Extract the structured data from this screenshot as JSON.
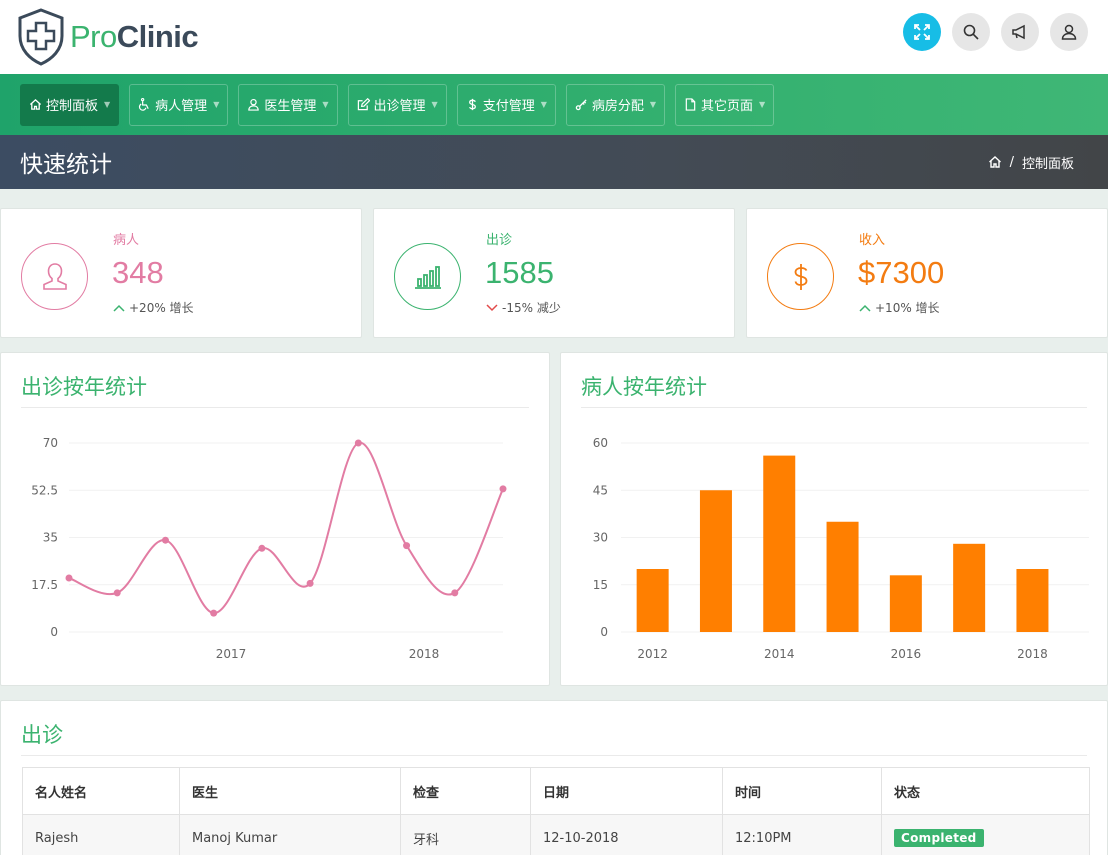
{
  "brand": {
    "part1": "Pro",
    "part2": "Clinic"
  },
  "nav": [
    {
      "label": "控制面板",
      "icon": "home-icon",
      "active": true
    },
    {
      "label": "病人管理",
      "icon": "wheelchair-icon"
    },
    {
      "label": "医生管理",
      "icon": "user-icon"
    },
    {
      "label": "出诊管理",
      "icon": "edit-icon"
    },
    {
      "label": "支付管理",
      "icon": "dollar-icon"
    },
    {
      "label": "病房分配",
      "icon": "key-icon"
    },
    {
      "label": "其它页面",
      "icon": "file-icon"
    }
  ],
  "page": {
    "title": "快速统计",
    "breadcrumb": "控制面板"
  },
  "stats": [
    {
      "label": "病人",
      "value": "348",
      "change": "+20% 增长",
      "trend": "up",
      "color": "#e27ca3",
      "icon": "user-icon"
    },
    {
      "label": "出诊",
      "value": "1585",
      "change": "-15% 减少",
      "trend": "down",
      "color": "#3bb36f",
      "icon": "bar-chart-icon"
    },
    {
      "label": "收入",
      "value": "$7300",
      "change": "+10% 增长",
      "trend": "up",
      "color": "#f37c12",
      "icon": "dollar-icon"
    }
  ],
  "chart_data": [
    {
      "type": "line",
      "title": "出诊按年统计",
      "x_tick_labels": [
        "2017",
        "2018"
      ],
      "y_ticks": [
        "0",
        "17.5",
        "35",
        "52.5",
        "70"
      ],
      "ylim": [
        0,
        70
      ],
      "values": [
        20,
        14.5,
        34,
        7,
        31,
        18,
        70,
        32,
        14.5,
        53
      ],
      "color": "#e27ca3",
      "grid": true
    },
    {
      "type": "bar",
      "title": "病人按年统计",
      "x_tick_labels": [
        "2012",
        "2014",
        "2016",
        "2018"
      ],
      "y_ticks": [
        "0",
        "15",
        "30",
        "45",
        "60"
      ],
      "ylim": [
        0,
        60
      ],
      "values": [
        20,
        45,
        56,
        35,
        18,
        28,
        20
      ],
      "color": "#ff7f00",
      "grid": true
    }
  ],
  "table": {
    "title": "出诊",
    "headers": [
      "名人姓名",
      "医生",
      "检查",
      "日期",
      "时间",
      "状态"
    ],
    "rows": [
      {
        "name": "Rajesh",
        "doctor": "Manoj Kumar",
        "check": "牙科",
        "date": "12-10-2018",
        "time": "12:10PM",
        "status": "Completed"
      }
    ]
  }
}
